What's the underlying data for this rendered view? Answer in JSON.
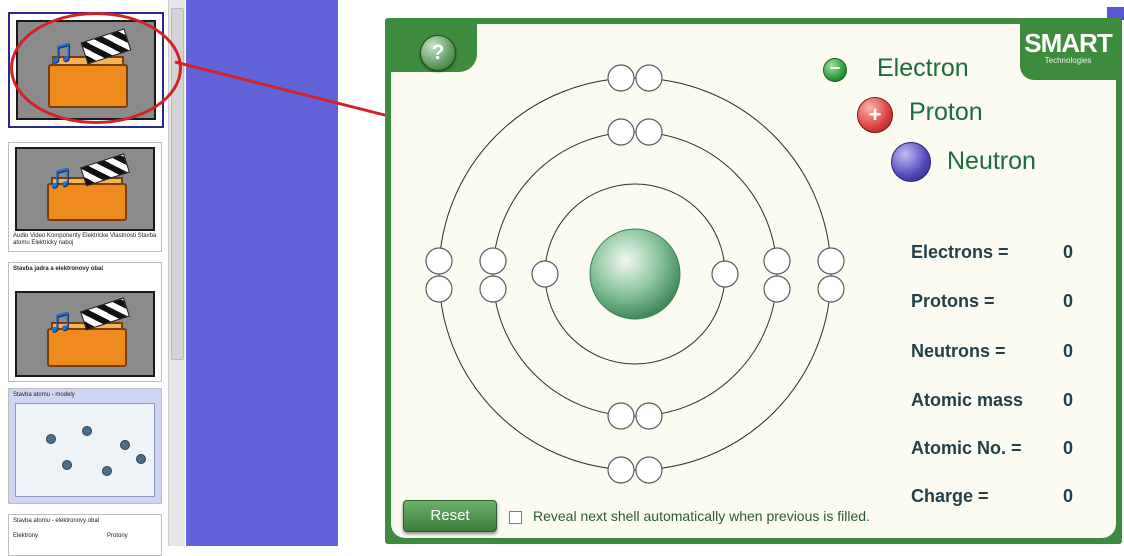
{
  "sidebar": {
    "thumb2_caption": "Audio Video Komponenty Elektricke Vlastnosti Stavba atomu Elektricky naboj",
    "thumb3_title": "Stavba jadra a elektronovy obal",
    "thumb4_title": "Stavba atomu - modely",
    "thumb5_title": "Stavba atomu - elektronovy obal",
    "thumb5_col1": "Elektrony",
    "thumb5_col2": "Protony"
  },
  "widget": {
    "help_label": "?",
    "logo": "SMART",
    "logo_sub": "Technologies"
  },
  "legend": {
    "electron": "Electron",
    "proton": "Proton",
    "proton_sign": "+",
    "neutron": "Neutron",
    "electron_sign": "−"
  },
  "stats": [
    {
      "label": "Electrons =",
      "value": "0"
    },
    {
      "label": "Protons =",
      "value": "0"
    },
    {
      "label": "Neutrons =",
      "value": "0"
    },
    {
      "label": "Atomic mass",
      "value": "0"
    },
    {
      "label": "Atomic No. =",
      "value": "0"
    },
    {
      "label": "Charge =",
      "value": "0"
    }
  ],
  "controls": {
    "reset": "Reset",
    "reveal_label": "Reveal next shell automatically when previous is filled.",
    "reveal_checked": false
  },
  "colors": {
    "frame_green": "#3d8c3d",
    "electron": "#2f9b3f",
    "proton": "#d8403c",
    "neutron": "#4f47b8",
    "annotation_red": "#d42027",
    "slide_purple": "#6262d9"
  }
}
